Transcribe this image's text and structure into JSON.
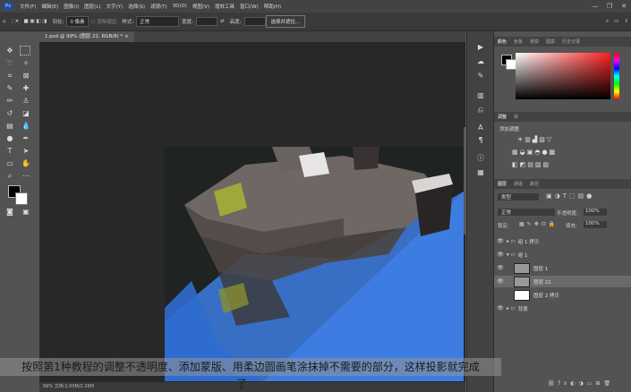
{
  "menubar": {
    "app_icon": "Ps",
    "items": [
      "文件(F)",
      "编辑(E)",
      "图像(I)",
      "图层(L)",
      "文字(Y)",
      "选择(S)",
      "滤镜(T)",
      "3D(D)",
      "视图(V)",
      "增效工具",
      "窗口(W)",
      "帮助(H)"
    ],
    "window_controls": [
      "—",
      "❐",
      "✕"
    ]
  },
  "options": {
    "feather_label": "羽化:",
    "feather_value": "0 像素",
    "antialias_label": "消除锯齿",
    "style_label": "样式:",
    "style_value": "正常",
    "width_label": "宽度:",
    "height_label": "高度:",
    "select_mask_button": "选择并遮住..."
  },
  "doc": {
    "tab_title": "1.psd @ 99% (图层 22, RGB/8) *",
    "tab_close": "×"
  },
  "status": {
    "text": "99%    文档:1.00M/2.26M"
  },
  "panels": {
    "color_tabs": [
      "颜色",
      "色板",
      "渐变",
      "图案",
      "历史记录"
    ],
    "adjust_tabs": [
      "调整",
      "库"
    ],
    "adjust_title": "添加调整",
    "layer_tabs": [
      "图层",
      "通道",
      "路径"
    ],
    "filter_kind": "类型",
    "blend_mode": "正常",
    "opacity_label": "不透明度:",
    "opacity_value": "100%",
    "lock_label": "锁定:",
    "fill_label": "填充:",
    "fill_value": "100%",
    "layers": [
      {
        "name": "组 1 拷贝",
        "type": "group"
      },
      {
        "name": "组 1",
        "type": "group"
      },
      {
        "name": "图层 1",
        "type": "layer"
      },
      {
        "name": "图层 22",
        "type": "layer",
        "selected": true
      },
      {
        "name": "图层 2 拷贝",
        "type": "layer"
      },
      {
        "name": "背景",
        "type": "group"
      }
    ]
  },
  "caption": {
    "line1": "按照第1种教程的调整不透明度、添加蒙版、用柔边圆画笔涂抹掉不需要的部分，这样投影就完成",
    "line2": "了"
  },
  "colors": {
    "canvas_bg": "#1f2321",
    "floor_blue": "#3d7de0",
    "sofa_gray": "#6f6764",
    "pillow_green": "#a0a83a",
    "brush_cursor": "#e8e83a"
  }
}
